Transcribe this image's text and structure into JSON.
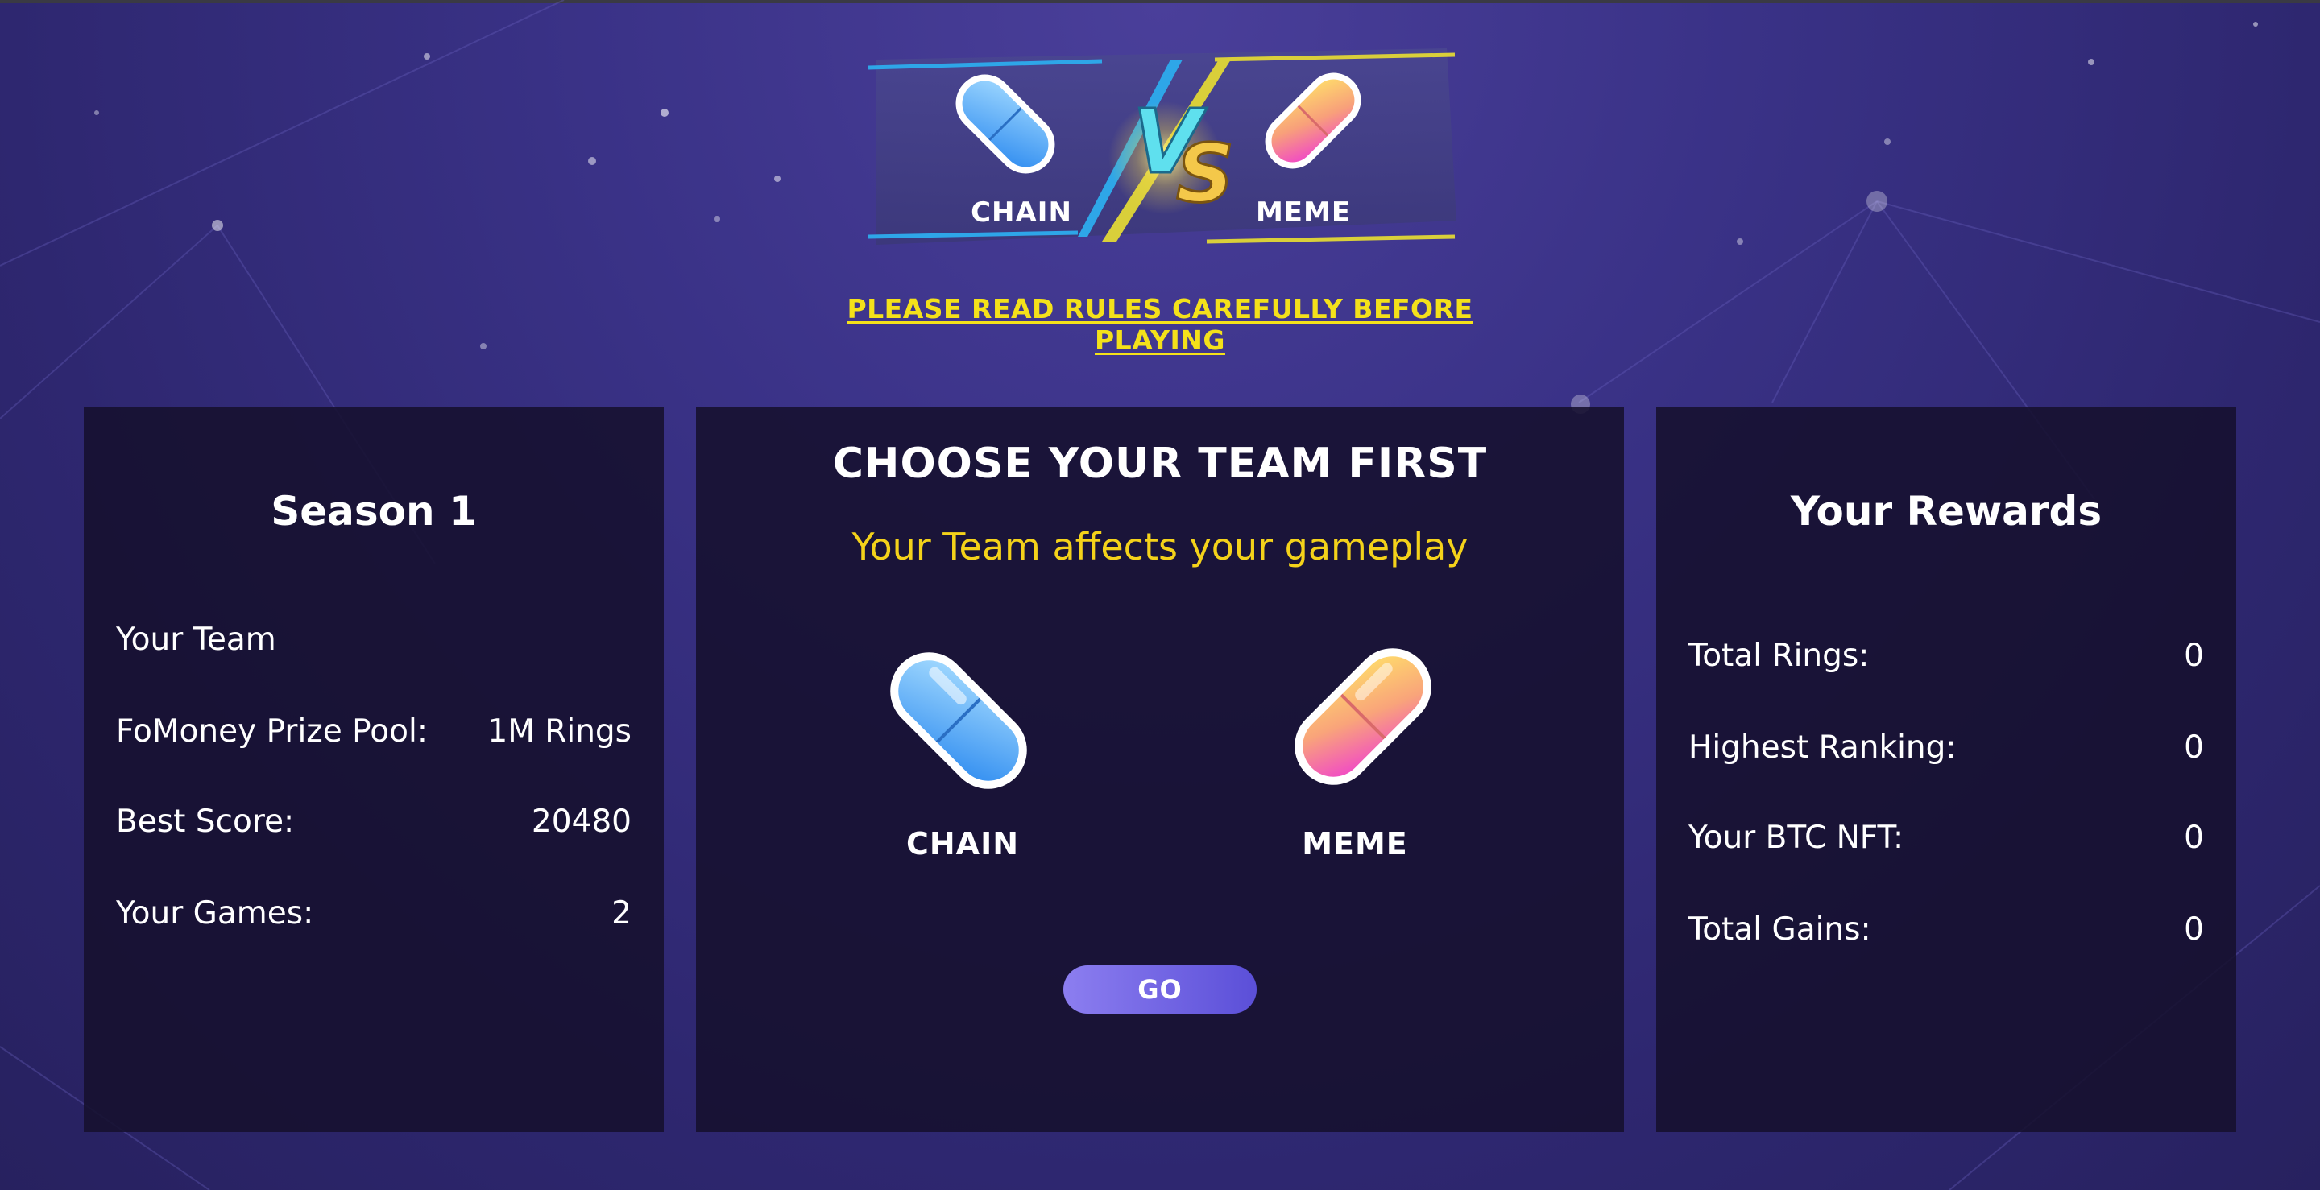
{
  "banner": {
    "left_team": "CHAIN",
    "right_team": "MEME",
    "vs_text": "VS"
  },
  "rules_link": "PLEASE READ RULES CAREFULLY BEFORE PLAYING",
  "season_panel": {
    "title": "Season 1",
    "rows": [
      {
        "label": "Your Team",
        "value": ""
      },
      {
        "label": "FoMoney Prize Pool:",
        "value": "1M Rings"
      },
      {
        "label": "Best Score:",
        "value": "20480"
      },
      {
        "label": "Your Games:",
        "value": "2"
      }
    ]
  },
  "team_panel": {
    "title": "CHOOSE YOUR TEAM FIRST",
    "subtitle": "Your Team affects your gameplay",
    "options": [
      {
        "name": "CHAIN",
        "icon": "blue-pill-icon"
      },
      {
        "name": "MEME",
        "icon": "pink-yellow-pill-icon"
      }
    ],
    "go_label": "GO"
  },
  "rewards_panel": {
    "title": "Your Rewards",
    "rows": [
      {
        "label": "Total Rings:",
        "value": "0"
      },
      {
        "label": "Highest Ranking:",
        "value": "0"
      },
      {
        "label": "Your BTC NFT:",
        "value": "0"
      },
      {
        "label": "Total Gains:",
        "value": "0"
      }
    ]
  },
  "colors": {
    "accent_yellow": "#f4e11a",
    "chain_blue": "#4aa3f5",
    "meme_pink": "#f25bd0",
    "meme_yellow": "#fbd04a",
    "go_button": "#6f62e4"
  }
}
